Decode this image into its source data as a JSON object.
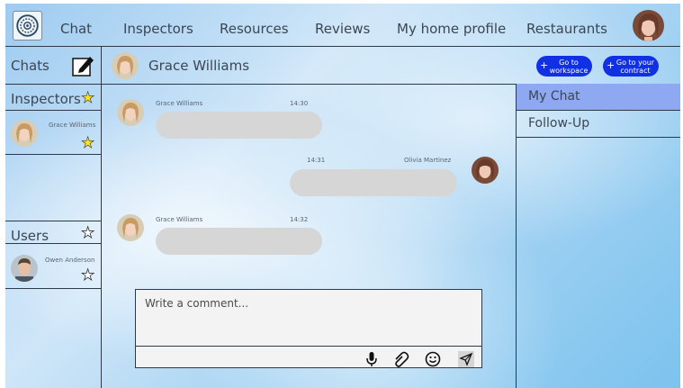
{
  "nav": {
    "items": [
      "Chat",
      "Inspectors",
      "Resources",
      "Reviews",
      "My home profile",
      "Restaurants"
    ]
  },
  "left": {
    "chats_label": "Chats",
    "inspectors_label": "Inspectors",
    "inspector_name": "Grace Williams",
    "users_label": "Users",
    "user_name": "Owen Anderson"
  },
  "chat": {
    "contact_name": "Grace Williams",
    "btn_workspace": "Go to workspace",
    "btn_contract": "Go to your contract",
    "messages": [
      {
        "name": "Grace Williams",
        "time": "14:30"
      },
      {
        "name": "Olivia Martinez",
        "time": "14:31"
      },
      {
        "name": "Grace Williams",
        "time": "14:32"
      }
    ],
    "composer_placeholder": "Write a comment..."
  },
  "right": {
    "tabs": [
      "My Chat",
      "Follow-Up"
    ]
  },
  "colors": {
    "button_blue": "#1030e6",
    "active_tab": "#8ea8f2",
    "star_yellow": "#ffe21a"
  }
}
